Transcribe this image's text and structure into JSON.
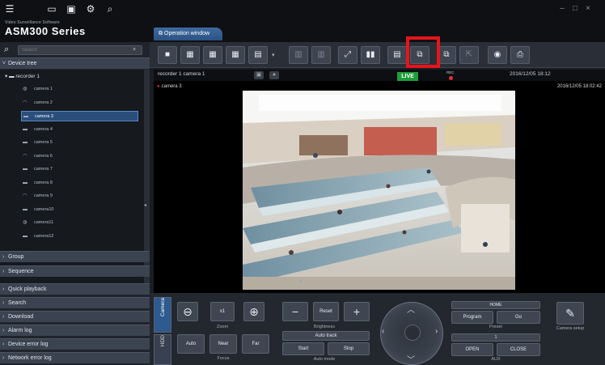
{
  "brand": {
    "small": "Video Surveillance Software",
    "big": "ASM300 Series"
  },
  "window_controls": {
    "minimize": "–",
    "restore": "□",
    "close": "×"
  },
  "search": {
    "placeholder": "Search",
    "clear": "×"
  },
  "sections": {
    "device_tree": "Device tree",
    "group": "Group",
    "sequence": "Sequence",
    "quick_playback": "Quick playback",
    "search": "Search",
    "download": "Download",
    "alarm_log": "Alarm log",
    "device_error_log": "Device error log",
    "network_error_log": "Network error log"
  },
  "tree": {
    "root": "recorder 1",
    "items": [
      {
        "label": "camera 1",
        "icon": "ptz-camera-icon"
      },
      {
        "label": "camera 2",
        "icon": "dome-camera-icon"
      },
      {
        "label": "camera 3",
        "icon": "box-camera-icon",
        "selected": true
      },
      {
        "label": "camera 4",
        "icon": "box-camera-icon"
      },
      {
        "label": "camera 5",
        "icon": "box-camera-icon"
      },
      {
        "label": "camera 6",
        "icon": "dome-camera-icon"
      },
      {
        "label": "camera 7",
        "icon": "box-camera-icon"
      },
      {
        "label": "camera 8",
        "icon": "box-camera-icon"
      },
      {
        "label": "camera 9",
        "icon": "dome-camera-icon"
      },
      {
        "label": "camera10",
        "icon": "box-camera-icon"
      },
      {
        "label": "camera11",
        "icon": "ptz-camera-icon"
      },
      {
        "label": "camera12",
        "icon": "box-camera-icon"
      }
    ]
  },
  "tabs": {
    "operation_window": "Operation window"
  },
  "status": {
    "source": "recorder 1 camera 1",
    "live": "LIVE",
    "rec": "REC",
    "time": "2016/12/05 18:12"
  },
  "viewer": {
    "camera_name": "camera 3",
    "timestamp": "2016/12/05 18:02:42"
  },
  "control": {
    "tabs": {
      "camera": "Camera",
      "hdd": "HDD"
    },
    "zoom": {
      "label": "Zoom",
      "x1": "x1",
      "minus": "−",
      "plus": "+"
    },
    "focus": {
      "label": "Focus",
      "auto": "Auto",
      "near": "Near",
      "far": "Far"
    },
    "brightness": {
      "label": "Brightness",
      "reset": "Reset",
      "minus": "−",
      "plus": "+"
    },
    "auto_mode": {
      "label": "Auto mode",
      "title": "Auto track",
      "start": "Start",
      "stop": "Stop"
    },
    "preset": {
      "label": "Preset",
      "home": "HOME",
      "program": "Program",
      "go": "Go"
    },
    "aux": {
      "label": "AUX",
      "value": "1",
      "open": "OPEN",
      "close": "CLOSE"
    },
    "camera_setup": {
      "label": "Camera setup"
    }
  },
  "colors": {
    "highlight": "#e8141b",
    "live": "#1e9e3a",
    "selected": "#2a4f7c",
    "rec": "#e33030"
  }
}
